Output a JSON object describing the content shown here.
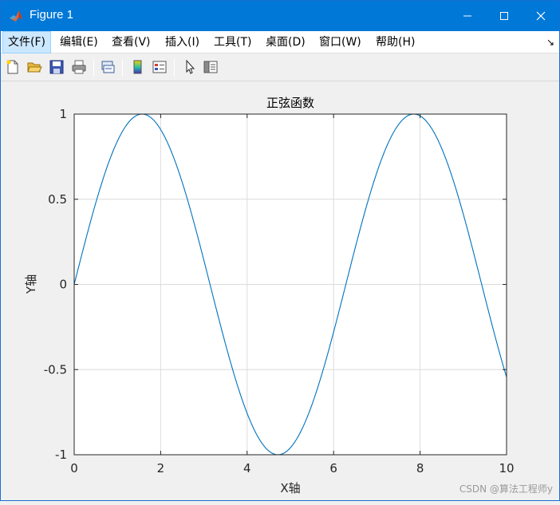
{
  "window": {
    "title": "Figure 1",
    "accent_color": "#0078d7",
    "buttons": [
      "minimize-icon",
      "maximize-icon",
      "close-icon"
    ]
  },
  "menubar": {
    "items": [
      {
        "label": "文件(F)"
      },
      {
        "label": "编辑(E)"
      },
      {
        "label": "查看(V)"
      },
      {
        "label": "插入(I)"
      },
      {
        "label": "工具(T)"
      },
      {
        "label": "桌面(D)"
      },
      {
        "label": "窗口(W)"
      },
      {
        "label": "帮助(H)"
      }
    ],
    "dock_arrow": "↘"
  },
  "toolbar": {
    "icons": [
      "new-figure-icon",
      "open-file-icon",
      "save-icon",
      "print-icon",
      "link-icon",
      "colorbar-icon",
      "legend-icon",
      "pointer-icon",
      "property-editor-icon"
    ]
  },
  "chart_data": {
    "type": "line",
    "title": "正弦函数",
    "xlabel": "X轴",
    "ylabel": "Y轴",
    "xlim": [
      0,
      10
    ],
    "ylim": [
      -1,
      1
    ],
    "xticks": [
      "0",
      "2",
      "4",
      "6",
      "8",
      "10"
    ],
    "yticks": [
      "1",
      "0.5",
      "0",
      "-0.5",
      "-1"
    ],
    "grid": true,
    "series": [
      {
        "function": "sin(x)",
        "x_start": 0,
        "x_end": 10,
        "color": "#0072bd"
      }
    ]
  },
  "watermark": "CSDN @算法工程师y"
}
